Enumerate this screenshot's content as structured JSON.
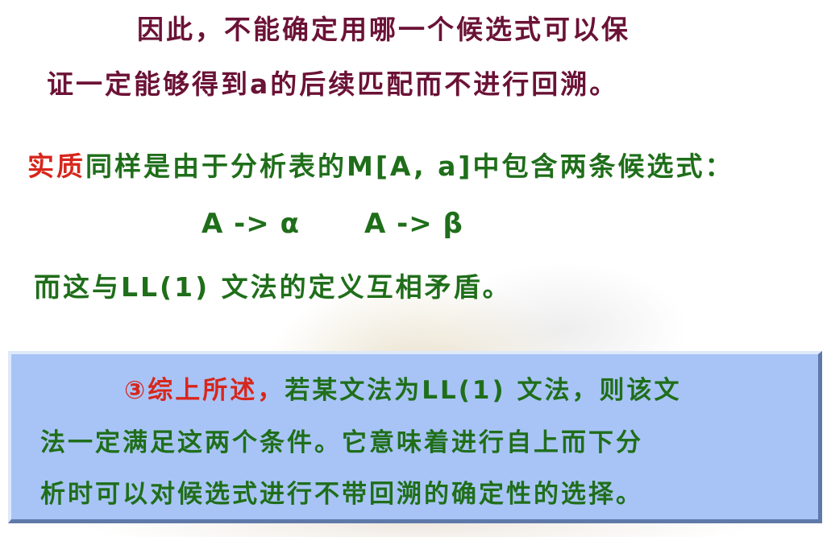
{
  "text": {
    "line1": "因此，不能确定用哪一个候选式可以保",
    "line2": "证一定能够得到a的后续匹配而不进行回溯。",
    "line3_highlight": "实质",
    "line3_rest": "同样是由于分析表的M[A, a]中包含两条候选式：",
    "line4_left": "A -> α",
    "line4_right": "A ->  β",
    "line5": "而这与LL(1) 文法的定义互相矛盾。"
  },
  "box": {
    "line1_highlight": "③综上所述，",
    "line1_rest": "若某文法为LL(1) 文法，则该文",
    "line2": "法一定满足这两个条件。它意味着进行自上而下分",
    "line3": "析时可以对候选式进行不带回溯的确定性的选择。"
  },
  "colors": {
    "title_text": "#6b1236",
    "body_text": "#1f6e1a",
    "highlight": "#d7261c",
    "box_fill": "#a8c4f6"
  }
}
